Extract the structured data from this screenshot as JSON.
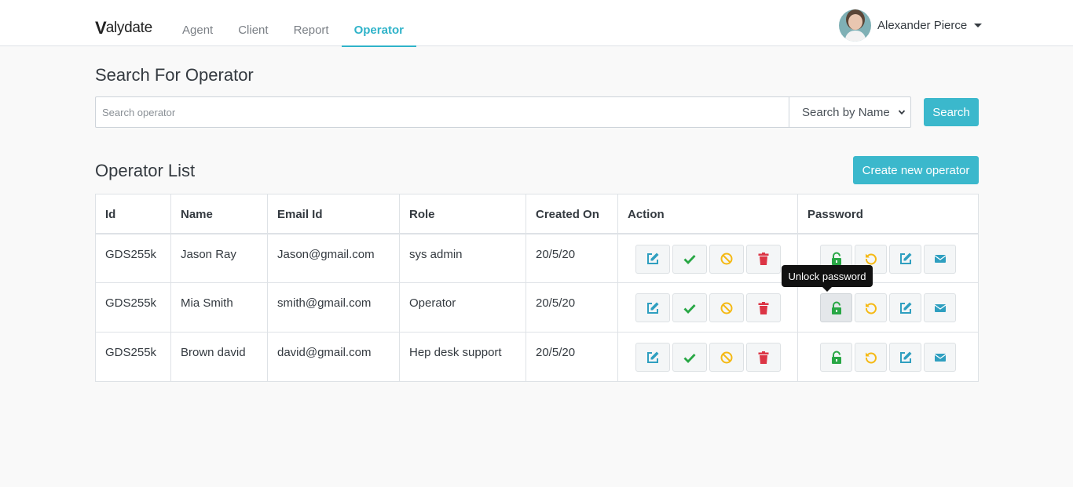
{
  "brand": {
    "first": "V",
    "rest": "alydate"
  },
  "nav": [
    {
      "label": "Agent"
    },
    {
      "label": "Client"
    },
    {
      "label": "Report"
    },
    {
      "label": "Operator"
    }
  ],
  "user": {
    "name": "Alexander Pierce"
  },
  "search": {
    "title": "Search For Operator",
    "placeholder": "Search operator",
    "select_value": "Search by Name",
    "button": "Search"
  },
  "list": {
    "title": "Operator List",
    "create_button": "Create new operator",
    "headers": {
      "id": "Id",
      "name": "Name",
      "email": "Email Id",
      "role": "Role",
      "created": "Created On",
      "action": "Action",
      "password": "Password"
    },
    "rows": [
      {
        "id": "GDS255k",
        "name": "Jason Ray",
        "email": "Jason@gmail.com",
        "role": "sys admin",
        "created": "20/5/20"
      },
      {
        "id": "GDS255k",
        "name": "Mia Smith",
        "email": "smith@gmail.com",
        "role": "Operator",
        "created": "20/5/20"
      },
      {
        "id": "GDS255k",
        "name": "Brown david",
        "email": "david@gmail.com",
        "role": "Hep desk support",
        "created": "20/5/20"
      }
    ]
  },
  "tooltip": {
    "text": "Unlock password"
  },
  "colors": {
    "accent": "#3bb8cc",
    "edit": "#2f9fc0",
    "approve": "#28a745",
    "block": "#f5b914",
    "delete": "#dc3545"
  },
  "icons": {
    "edit": "edit-icon",
    "approve": "check-icon",
    "block": "ban-icon",
    "delete": "trash-icon",
    "unlock": "unlock-icon",
    "reset": "undo-icon",
    "email": "envelope-icon"
  }
}
